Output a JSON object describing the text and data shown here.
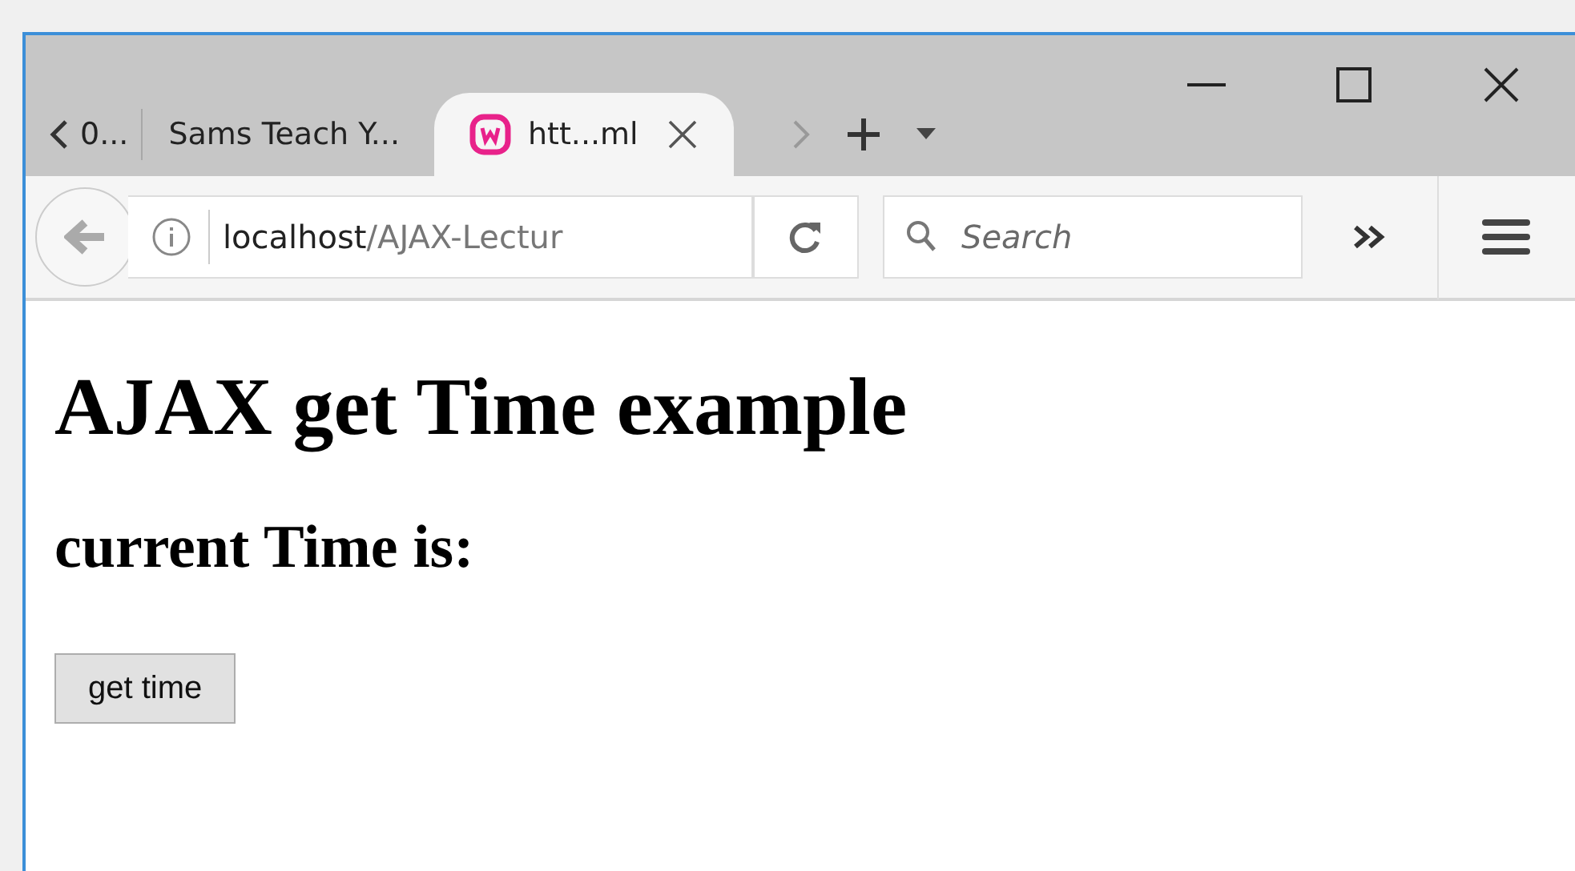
{
  "tabs": [
    {
      "title": "0...",
      "selected": false
    },
    {
      "title": "Sams Teach Y...",
      "selected": false
    },
    {
      "title": "htt...ml",
      "selected": true
    }
  ],
  "address_bar": {
    "host": "localhost",
    "path": "/AJAX-Lectur"
  },
  "search": {
    "placeholder": "Search"
  },
  "page": {
    "heading": "AJAX get Time example",
    "subheading": "current Time is:",
    "button": "get time"
  }
}
